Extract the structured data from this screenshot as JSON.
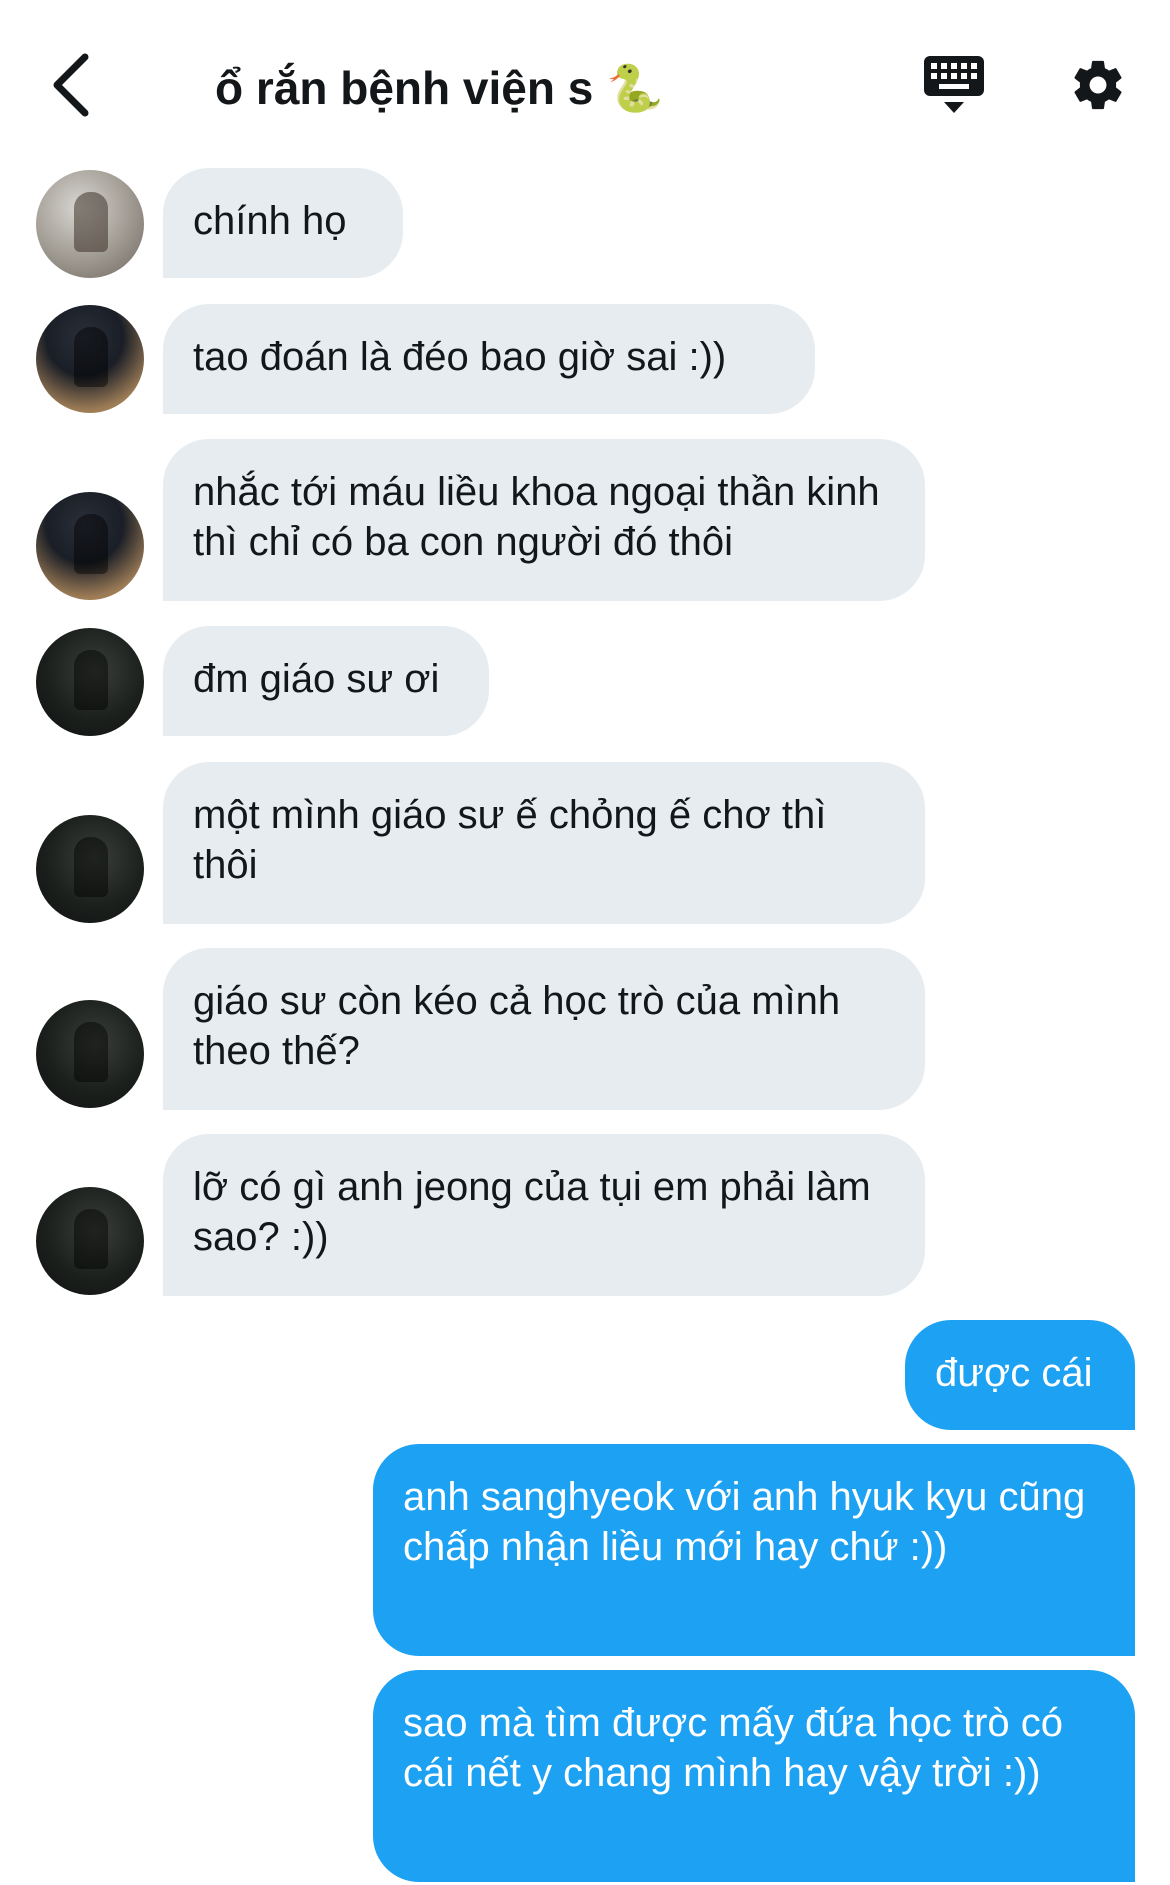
{
  "header": {
    "title": "ổ rắn bệnh viện s 🐍",
    "back_icon": "chevron-left-icon",
    "keyboard_icon": "keyboard-icon",
    "settings_icon": "gear-icon"
  },
  "colors": {
    "incoming_bubble": "#e6ecf0",
    "outgoing_bubble": "#1da1f2",
    "text": "#14171a"
  },
  "messages": [
    {
      "direction": "in",
      "sender_avatar": "avatar-a",
      "text": "chính họ"
    },
    {
      "direction": "in",
      "sender_avatar": "avatar-b",
      "text": "tao đoán là đéo bao giờ sai :))"
    },
    {
      "direction": "in",
      "sender_avatar": "avatar-b",
      "text": "nhắc tới máu liều khoa ngoại thần kinh thì chỉ có ba con người đó thôi"
    },
    {
      "direction": "in",
      "sender_avatar": "avatar-c",
      "text": "đm giáo sư ơi"
    },
    {
      "direction": "in",
      "sender_avatar": "avatar-c",
      "text": "một mình giáo sư ế chỏng ế chơ thì thôi"
    },
    {
      "direction": "in",
      "sender_avatar": "avatar-c",
      "text": "giáo sư còn kéo cả học trò của mình theo thế?"
    },
    {
      "direction": "in",
      "sender_avatar": "avatar-c",
      "text": "lỡ có gì anh jeong của tụi em phải làm sao? :))"
    },
    {
      "direction": "out",
      "text": "được cái"
    },
    {
      "direction": "out",
      "text": "anh sanghyeok với anh hyuk kyu cũng chấp nhận liều mới hay chứ :))"
    },
    {
      "direction": "out",
      "text": "sao mà tìm được mấy đứa học trò có cái nết y chang mình hay vậy trời :))"
    }
  ]
}
